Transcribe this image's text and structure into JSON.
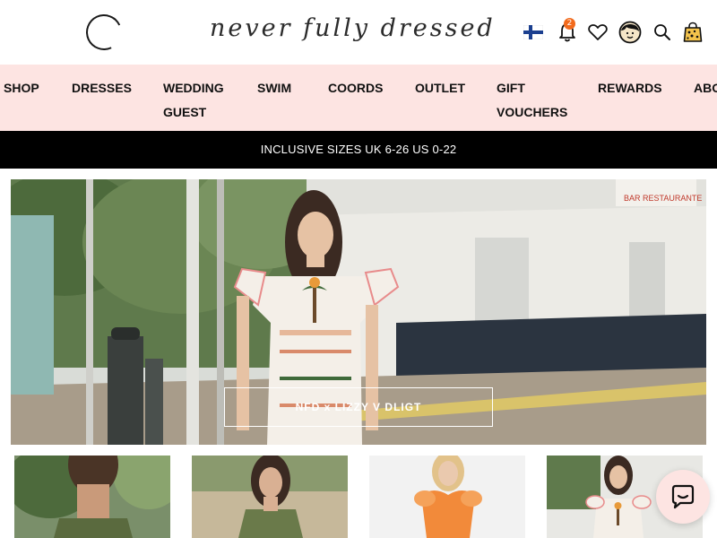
{
  "brand": {
    "logo_text": "never fully dressed"
  },
  "header": {
    "notification_count": "2",
    "icons": [
      "finland-flag-icon",
      "bell-icon",
      "heart-icon",
      "face-icon",
      "search-icon",
      "shopping-bag-icon"
    ]
  },
  "nav": {
    "items": [
      {
        "label": "SHOP"
      },
      {
        "label": "DRESSES"
      },
      {
        "label": "WEDDING GUEST"
      },
      {
        "label": "SWIM"
      },
      {
        "label": "COORDS"
      },
      {
        "label": "OUTLET"
      },
      {
        "label": "GIFT VOUCHERS"
      },
      {
        "label": "REWARDS"
      },
      {
        "label": "ABO"
      }
    ]
  },
  "announcement": {
    "text": "INCLUSIVE SIZES UK 6-26 US 0-22"
  },
  "hero": {
    "button_label": "NFD x LIZZY V DLIGT",
    "storefront_sign": "BAR RESTAURANTE"
  },
  "colors": {
    "nav_bg": "#fde4e2",
    "announce_bg": "#000000",
    "badge": "#f26a1c",
    "chat_bg": "#fde4e2"
  }
}
